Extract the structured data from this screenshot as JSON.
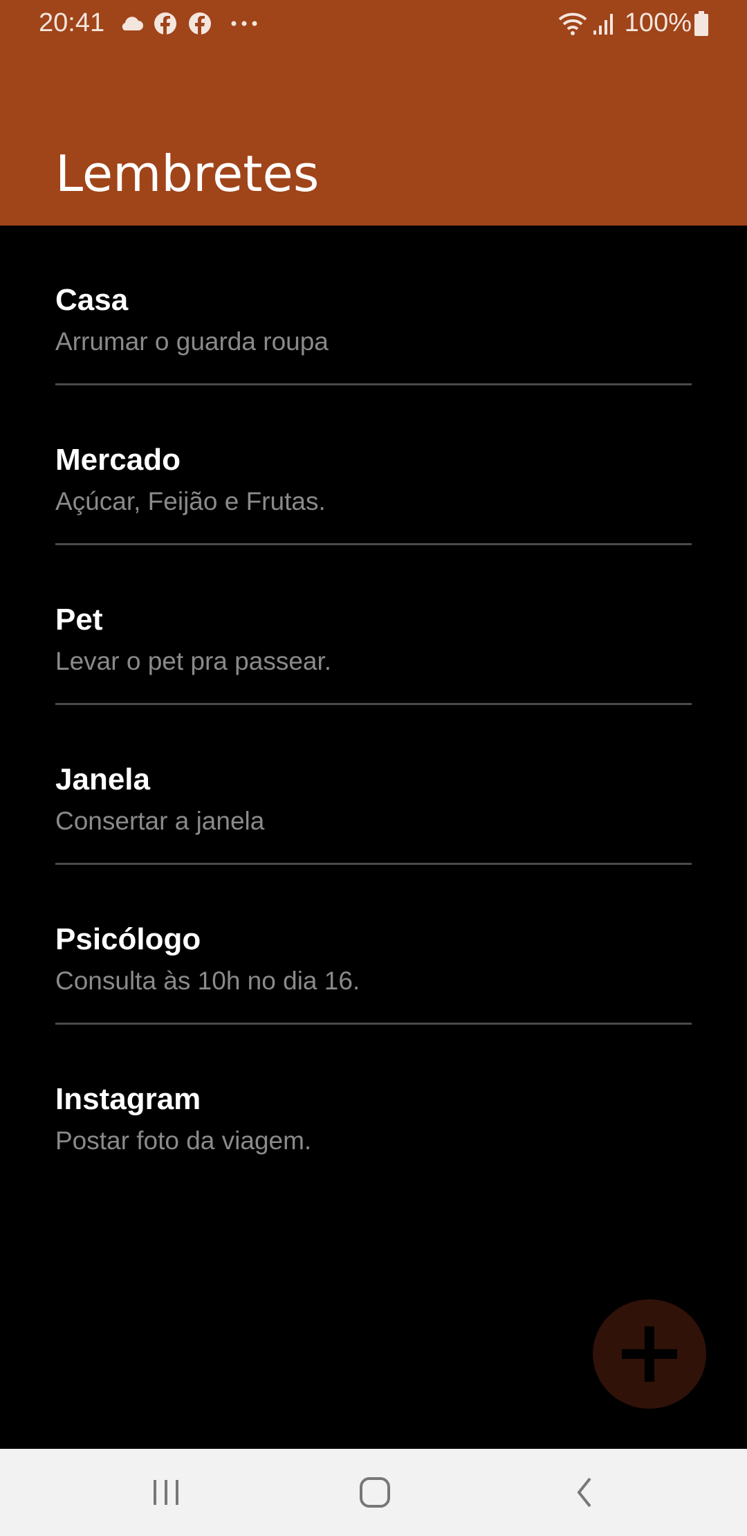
{
  "status_bar": {
    "time": "20:41",
    "left_icons": [
      "cloud-icon",
      "facebook-icon",
      "facebook-icon",
      "more-dots-icon"
    ],
    "right_icons": [
      "wifi-icon",
      "signal-icon",
      "battery-icon"
    ],
    "battery": "100%"
  },
  "app_bar": {
    "title": "Lembretes",
    "color": "#a0441a"
  },
  "reminders": [
    {
      "title": "Casa",
      "description": "Arrumar o guarda roupa"
    },
    {
      "title": "Mercado",
      "description": "Açúcar, Feijão e Frutas."
    },
    {
      "title": "Pet",
      "description": "Levar o pet pra passear."
    },
    {
      "title": "Janela",
      "description": "Consertar a janela"
    },
    {
      "title": "Psicólogo",
      "description": "Consulta às 10h no dia 16."
    },
    {
      "title": "Instagram",
      "description": "Postar foto da viagem."
    }
  ],
  "fab": {
    "icon": "plus-icon",
    "color": "#301208"
  },
  "nav_bar": {
    "buttons": [
      "recent-apps-icon",
      "home-icon",
      "back-icon"
    ]
  }
}
